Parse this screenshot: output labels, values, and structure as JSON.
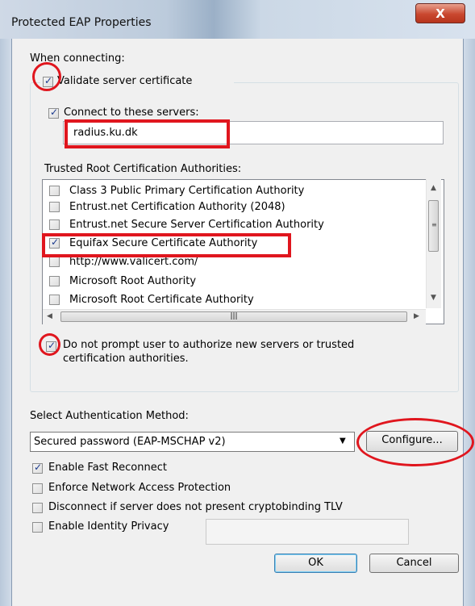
{
  "window": {
    "title": "Protected EAP Properties",
    "close_label": "X"
  },
  "connecting": {
    "heading": "When connecting:",
    "validate_label": "Validate server certificate",
    "validate_checked": true,
    "connect_label": "Connect to these servers:",
    "connect_checked": true,
    "servers_value": "radius.ku.dk",
    "trusted_label": "Trusted Root Certification Authorities:",
    "authorities": [
      {
        "label": "Class 3 Public Primary Certification Authority",
        "checked": false
      },
      {
        "label": "Entrust.net Certification Authority (2048)",
        "checked": false
      },
      {
        "label": "Entrust.net Secure Server Certification Authority",
        "checked": false
      },
      {
        "label": "Equifax Secure Certificate Authority",
        "checked": true
      },
      {
        "label": "http://www.valicert.com/",
        "checked": false
      },
      {
        "label": "Microsoft Root Authority",
        "checked": false
      },
      {
        "label": "Microsoft Root Certificate Authority",
        "checked": false
      }
    ],
    "no_prompt_line1": "Do not prompt user to authorize new servers or trusted",
    "no_prompt_line2": "certification authorities.",
    "no_prompt_checked": true
  },
  "auth": {
    "label": "Select Authentication Method:",
    "method_value": "Secured password (EAP-MSCHAP v2)",
    "configure_label": "Configure...",
    "options": [
      {
        "label": "Enable Fast Reconnect",
        "checked": true
      },
      {
        "label": "Enforce Network Access Protection",
        "checked": false
      },
      {
        "label": "Disconnect if server does not present cryptobinding TLV",
        "checked": false
      },
      {
        "label": "Enable Identity Privacy",
        "checked": false
      }
    ]
  },
  "buttons": {
    "ok_label": "OK",
    "cancel_label": "Cancel"
  },
  "colors": {
    "annotation_red": "#e0161e",
    "check_blue": "#1b3a8e"
  }
}
